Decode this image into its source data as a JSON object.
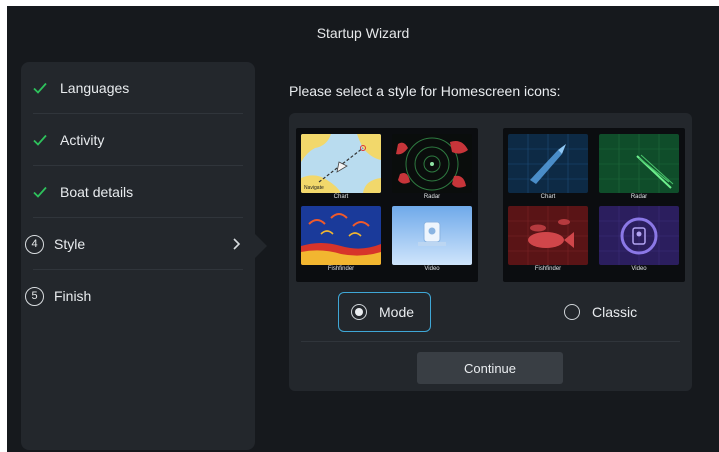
{
  "wizard": {
    "title": "Startup Wizard"
  },
  "steps": [
    {
      "label": "Languages",
      "state": "done"
    },
    {
      "label": "Activity",
      "state": "done"
    },
    {
      "label": "Boat details",
      "state": "done"
    },
    {
      "label": "Style",
      "number": "4",
      "state": "current"
    },
    {
      "label": "Finish",
      "number": "5",
      "state": "pending"
    }
  ],
  "main": {
    "heading": "Please select a style for Homescreen icons:",
    "options": [
      {
        "label": "Mode",
        "selected": true,
        "tiles": [
          {
            "label": "Chart",
            "icon": "chart-icon",
            "inner": "Navigate"
          },
          {
            "label": "Radar",
            "icon": "radar-icon"
          },
          {
            "label": "Fishfinder",
            "icon": "fishfinder-icon"
          },
          {
            "label": "Video",
            "icon": "video-icon"
          }
        ]
      },
      {
        "label": "Classic",
        "selected": false,
        "tiles": [
          {
            "label": "Chart",
            "icon": "chart-icon"
          },
          {
            "label": "Radar",
            "icon": "radar-icon"
          },
          {
            "label": "Fishfinder",
            "icon": "fishfinder-icon"
          },
          {
            "label": "Video",
            "icon": "video-icon"
          }
        ]
      }
    ],
    "continue_label": "Continue"
  },
  "colors": {
    "accent": "#2ec25c",
    "selection_border": "#3fa7d6",
    "background": "#16191d",
    "panel": "#23272c"
  }
}
